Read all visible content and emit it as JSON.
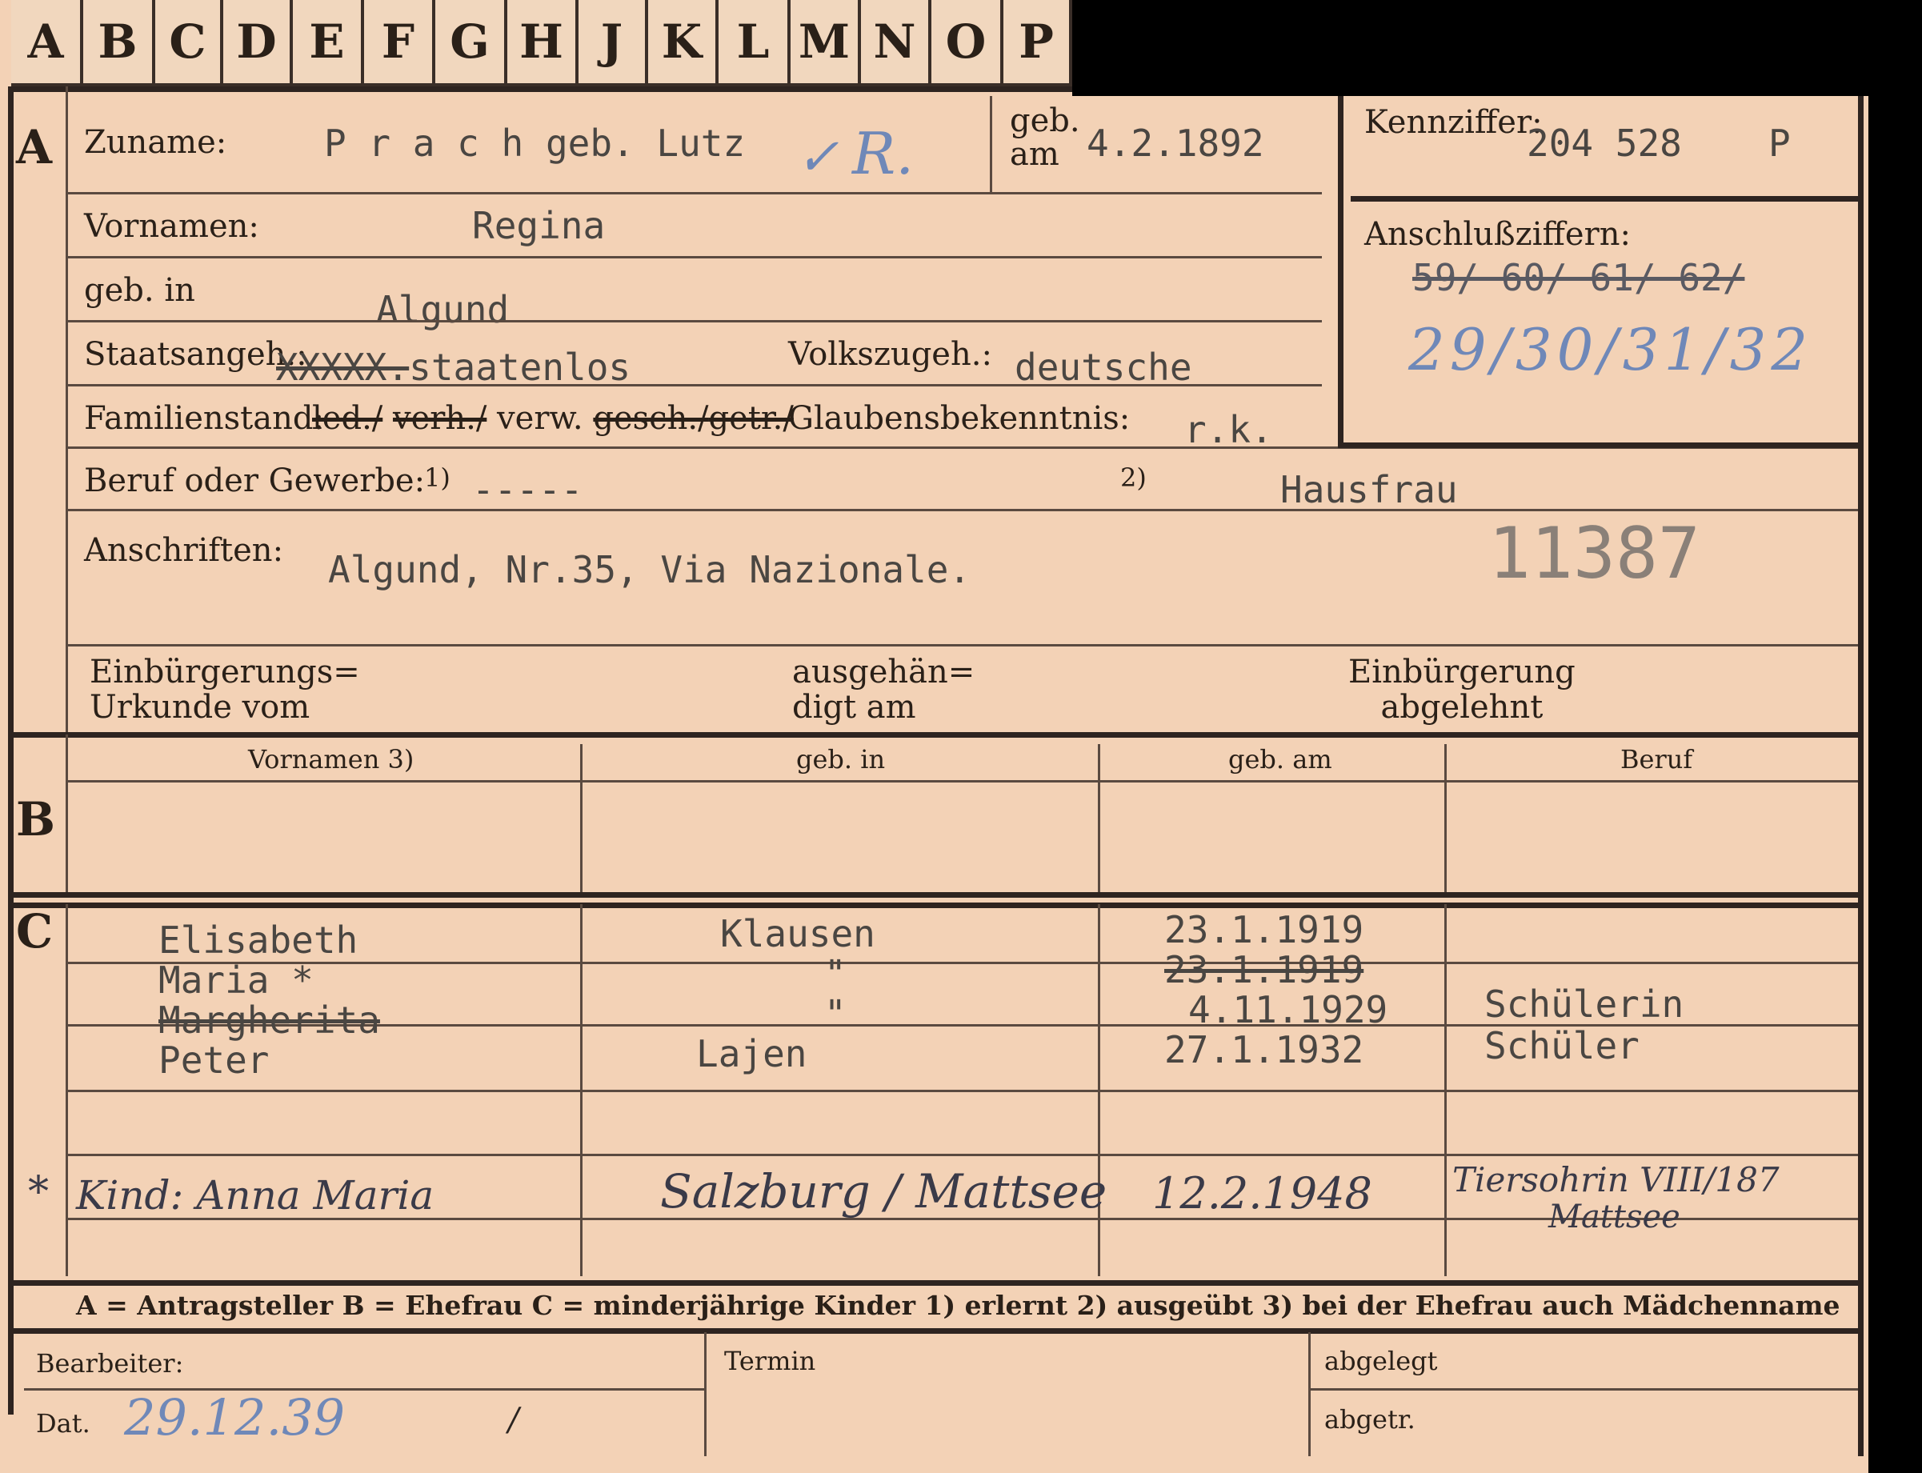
{
  "tabs": [
    "A",
    "B",
    "C",
    "D",
    "E",
    "F",
    "G",
    "H",
    "J",
    "K",
    "L",
    "M",
    "N",
    "O",
    "P"
  ],
  "sections": {
    "a": "A",
    "b": "B",
    "c": "C"
  },
  "applicant": {
    "surname_label": "Zuname:",
    "surname_value": "P r a c h geb. Lutz",
    "surname_mark": "R.",
    "check_mark": "✓",
    "born_on_label_1": "geb.",
    "born_on_label_2": "am",
    "born_on_value": "4.2.1892",
    "first_names_label": "Vornamen:",
    "first_names_value": "Regina",
    "birthplace_label": "geb. in",
    "birthplace_value": "Algund",
    "citizenship_label": "Staatsangeh.:",
    "citizenship_struck": "XXXXX.",
    "citizenship_value": "staatenlos",
    "ethnicity_label": "Volkszugeh.:",
    "ethnicity_value": "deutsche",
    "marital_label": "Familienstand:",
    "marital_opt_1": "led./",
    "marital_opt_2": "verh./",
    "marital_opt_3": "verw.",
    "marital_opt_4": "gesch./",
    "marital_opt_5": "getr./",
    "religion_label": "Glaubensbekenntnis:",
    "religion_value": "r.k.",
    "occupation_label": "Beruf oder Gewerbe:",
    "occupation_sup_1": "1)",
    "occupation_value_1": "-----",
    "occupation_sup_2": "2)",
    "occupation_value_2": "Hausfrau",
    "address_label": "Anschriften:",
    "address_value": "Algund, Nr.35, Via Nazionale.",
    "address_stamp": "11387",
    "naturalization_label_1": "Einbürgerungs=",
    "naturalization_label_2": "Urkunde vom",
    "handed_label_1": "ausgehän=",
    "handed_label_2": "digt am",
    "refused_label_1": "Einbürgerung",
    "refused_label_2": "abgelehnt"
  },
  "id_box": {
    "label": "Kennziffer:",
    "value": "204 528",
    "suffix": "P",
    "connection_label": "Anschlußziffern:",
    "connection_struck": "59/ 60/ 61/ 62/",
    "connection_new": "29/30/31/32"
  },
  "spouse_table": {
    "headers": [
      "Vornamen 3)",
      "geb. in",
      "geb. am",
      "Beruf"
    ]
  },
  "children": [
    {
      "name": "Elisabeth",
      "place": "Klausen",
      "date": "23.1.1919",
      "occupation": ""
    },
    {
      "name": "Maria *",
      "place": "\"",
      "date": "23.1.1919",
      "occupation": ""
    },
    {
      "name": "Margherita",
      "place": "\"",
      "date": "4.11.1929",
      "occupation": "Schülerin"
    },
    {
      "name": "Peter",
      "place": "Lajen",
      "date": "27.1.1932",
      "occupation": "Schüler"
    }
  ],
  "child_note": {
    "marker": "*",
    "name": "Kind: Anna Maria",
    "place": "Salzburg / Mattsee",
    "date": "12.2.1948",
    "occupation": "Tiersohrin VIII/187",
    "occupation_2": "Mattsee"
  },
  "legend": "A = Antragsteller   B = Ehefrau   C = minderjährige Kinder   1) erlernt   2) ausgeübt   3) bei der Ehefrau auch Mädchenname",
  "footer": {
    "clerk_label": "Bearbeiter:",
    "date_label": "Dat.",
    "date_value": "29.12.39",
    "date_slash": "/",
    "deadline_label": "Termin",
    "filed_label": "abgelegt",
    "sent_label": "abgetr."
  },
  "colors": {
    "card": "#f3d2b6",
    "ink_blue": "#6f88b8",
    "typewriter": "#4a4642"
  }
}
